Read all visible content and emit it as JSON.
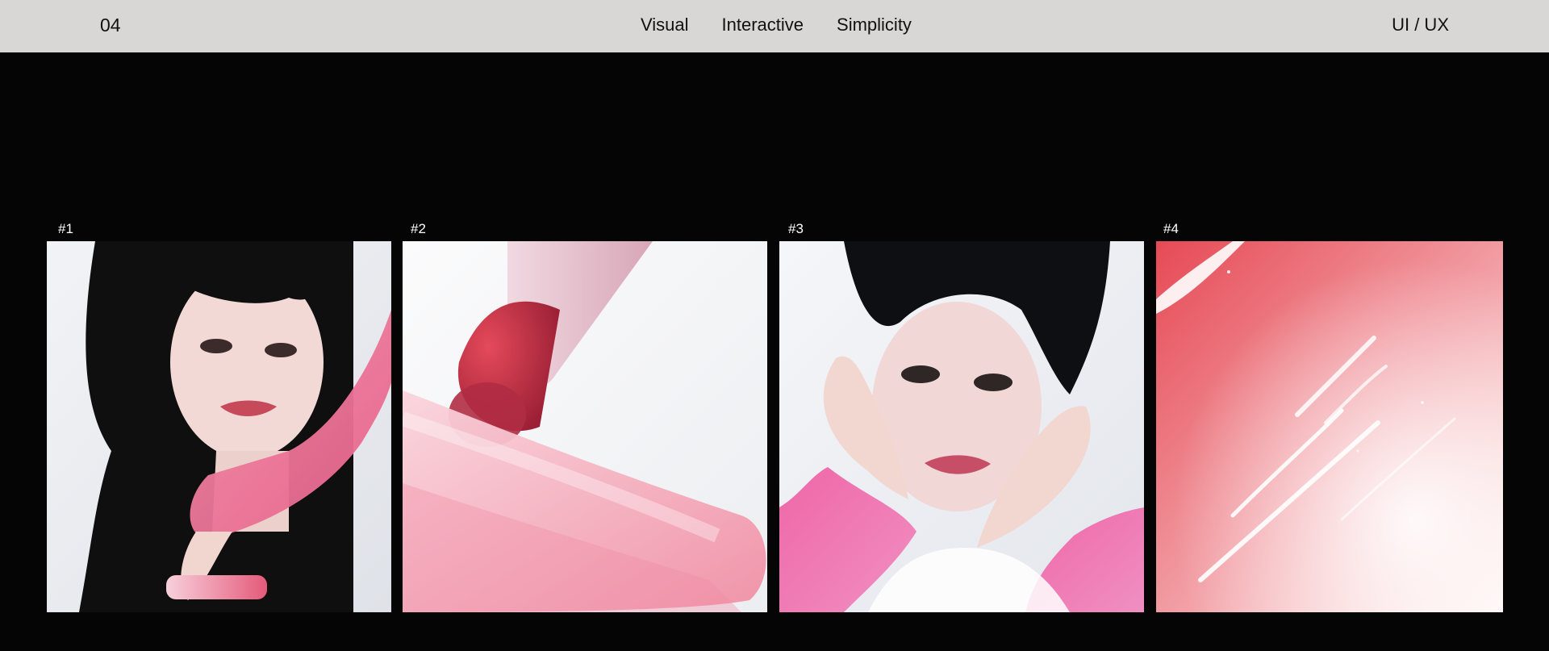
{
  "header": {
    "section_number": "04",
    "nav": [
      "Visual",
      "Interactive",
      "Simplicity"
    ],
    "category": "UI / UX"
  },
  "cards": [
    {
      "label": "#1",
      "icon": "portrait-photo"
    },
    {
      "label": "#2",
      "icon": "lipstick-photo"
    },
    {
      "label": "#3",
      "icon": "portrait-photo"
    },
    {
      "label": "#4",
      "icon": "gloss-texture-photo"
    }
  ],
  "colors": {
    "header_bg": "#d8d7d5",
    "page_bg": "#050505",
    "accent_pink": "#ec6f95",
    "accent_red": "#e24b57"
  }
}
